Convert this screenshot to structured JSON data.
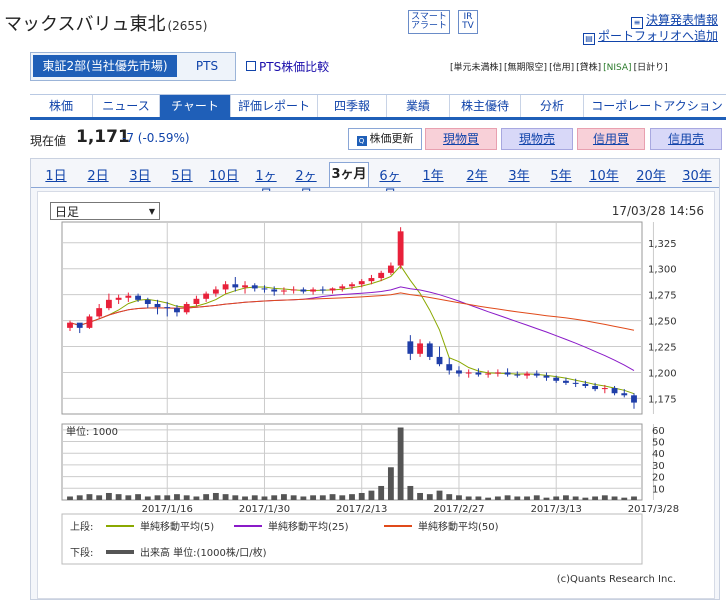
{
  "header": {
    "company": "マックスバリュ東北",
    "code": "(2655)",
    "alert_btn_line1": "スマート",
    "alert_btn_line2": "アラート",
    "ir_btn_line1": "IR",
    "ir_btn_line2": "TV",
    "link_earnings": "決算発表情報",
    "link_portfolio": "ポートフォリオへ追加"
  },
  "market": {
    "primary": "東証2部(当社優先市場)",
    "pts": "PTS",
    "pts_compare": "PTS株価比較"
  },
  "badges": [
    "[単元未満株]",
    "[無期限空]",
    "[信用]",
    "[貸株]",
    "[NISA]",
    "[日計り]"
  ],
  "tabs": [
    "株価",
    "ニュース",
    "チャート",
    "評価レポート",
    "四季報",
    "業績",
    "株主優待",
    "分析",
    "コーポレートアクション"
  ],
  "active_tab": "チャート",
  "quote": {
    "label": "現在値",
    "price": "1,171",
    "change": "-7 (-0.59%)",
    "refresh": "株価更新",
    "spot_buy": "現物買",
    "spot_sell": "現物売",
    "margin_buy": "信用買",
    "margin_sell": "信用売"
  },
  "periods": [
    "1日",
    "2日",
    "3日",
    "5日",
    "10日",
    "1ヶ月",
    "2ヶ月",
    "3ヶ月",
    "6ヶ月",
    "1年",
    "2年",
    "3年",
    "5年",
    "10年",
    "20年",
    "30年"
  ],
  "active_period": "3ヶ月",
  "chart_controls": {
    "interval": "日足",
    "timestamp": "17/03/28 14:56"
  },
  "chart_data": {
    "type": "candlestick",
    "price_ticks": [
      1175,
      1200,
      1225,
      1250,
      1275,
      1300,
      1325
    ],
    "price_tick_labels": [
      "1,175",
      "1,200",
      "1,225",
      "1,250",
      "1,275",
      "1,300",
      "1,325"
    ],
    "ylim": [
      1160,
      1345
    ],
    "volume_unit_label": "単位: 1000",
    "volume_ticks": [
      10,
      20,
      30,
      40,
      50,
      60
    ],
    "volume_ylim": [
      0,
      65
    ],
    "x_labels": [
      "2017/1/16",
      "2017/1/30",
      "2017/2/13",
      "2017/2/27",
      "2017/3/13",
      "2017/3/28"
    ],
    "x_label_index": [
      10,
      20,
      30,
      40,
      50,
      60
    ],
    "candles": [
      [
        1243,
        1250,
        1240,
        1248
      ],
      [
        1248,
        1246,
        1238,
        1243
      ],
      [
        1243,
        1256,
        1242,
        1254
      ],
      [
        1254,
        1266,
        1252,
        1262
      ],
      [
        1262,
        1276,
        1260,
        1270
      ],
      [
        1270,
        1275,
        1266,
        1272
      ],
      [
        1272,
        1277,
        1268,
        1274
      ],
      [
        1274,
        1276,
        1268,
        1270
      ],
      [
        1270,
        1272,
        1262,
        1266
      ],
      [
        1266,
        1270,
        1256,
        1263
      ],
      [
        1263,
        1268,
        1254,
        1262
      ],
      [
        1262,
        1265,
        1254,
        1258
      ],
      [
        1258,
        1268,
        1256,
        1266
      ],
      [
        1266,
        1274,
        1264,
        1271
      ],
      [
        1271,
        1278,
        1268,
        1276
      ],
      [
        1276,
        1283,
        1273,
        1280
      ],
      [
        1280,
        1288,
        1276,
        1285
      ],
      [
        1285,
        1292,
        1278,
        1282
      ],
      [
        1282,
        1288,
        1276,
        1284
      ],
      [
        1284,
        1286,
        1278,
        1281
      ],
      [
        1281,
        1284,
        1277,
        1280
      ],
      [
        1280,
        1283,
        1274,
        1278
      ],
      [
        1278,
        1282,
        1275,
        1279
      ],
      [
        1279,
        1283,
        1276,
        1280
      ],
      [
        1280,
        1282,
        1276,
        1278
      ],
      [
        1278,
        1282,
        1275,
        1280
      ],
      [
        1280,
        1283,
        1276,
        1279
      ],
      [
        1279,
        1282,
        1276,
        1281
      ],
      [
        1281,
        1285,
        1278,
        1283
      ],
      [
        1283,
        1287,
        1280,
        1285
      ],
      [
        1285,
        1290,
        1282,
        1288
      ],
      [
        1288,
        1294,
        1285,
        1291
      ],
      [
        1291,
        1298,
        1288,
        1296
      ],
      [
        1296,
        1306,
        1294,
        1303
      ],
      [
        1303,
        1340,
        1300,
        1336
      ],
      [
        1230,
        1236,
        1212,
        1218
      ],
      [
        1218,
        1232,
        1215,
        1228
      ],
      [
        1228,
        1230,
        1212,
        1215
      ],
      [
        1215,
        1225,
        1206,
        1208
      ],
      [
        1208,
        1214,
        1198,
        1202
      ],
      [
        1202,
        1206,
        1196,
        1199
      ],
      [
        1199,
        1203,
        1195,
        1200
      ],
      [
        1200,
        1204,
        1196,
        1198
      ],
      [
        1198,
        1202,
        1195,
        1199
      ],
      [
        1199,
        1203,
        1196,
        1200
      ],
      [
        1200,
        1204,
        1196,
        1198
      ],
      [
        1198,
        1201,
        1195,
        1197
      ],
      [
        1197,
        1201,
        1194,
        1199
      ],
      [
        1199,
        1202,
        1195,
        1197
      ],
      [
        1197,
        1200,
        1192,
        1195
      ],
      [
        1195,
        1197,
        1190,
        1192
      ],
      [
        1192,
        1195,
        1188,
        1190
      ],
      [
        1190,
        1194,
        1186,
        1189
      ],
      [
        1189,
        1192,
        1185,
        1187
      ],
      [
        1187,
        1190,
        1182,
        1184
      ],
      [
        1184,
        1188,
        1180,
        1185
      ],
      [
        1185,
        1187,
        1178,
        1180
      ],
      [
        1180,
        1184,
        1176,
        1178
      ],
      [
        1178,
        1180,
        1165,
        1171
      ]
    ],
    "volume": [
      3,
      4,
      5,
      4,
      6,
      5,
      4,
      5,
      3,
      4,
      4,
      5,
      4,
      3,
      5,
      6,
      5,
      4,
      3,
      4,
      3,
      4,
      5,
      4,
      3,
      4,
      4,
      5,
      4,
      5,
      6,
      8,
      12,
      28,
      62,
      12,
      6,
      5,
      8,
      5,
      4,
      3,
      3,
      2,
      3,
      4,
      3,
      3,
      4,
      2,
      3,
      4,
      3,
      2,
      3,
      4,
      3,
      2,
      3
    ],
    "legend": {
      "upper_label": "上段:",
      "lower_label": "下段:",
      "series": [
        {
          "name": "単純移動平均(5)",
          "color": "#8aa800"
        },
        {
          "name": "単純移動平均(25)",
          "color": "#8a1ac8"
        },
        {
          "name": "単純移動平均(50)",
          "color": "#e04a1a"
        }
      ],
      "volume_name": "出来高 単位:(1000株/口/枚)"
    },
    "colors": {
      "up": "#e8213a",
      "down": "#1f3ea8",
      "volume": "#555555"
    }
  },
  "footer": {
    "credit": "(c)Quants Research Inc."
  }
}
